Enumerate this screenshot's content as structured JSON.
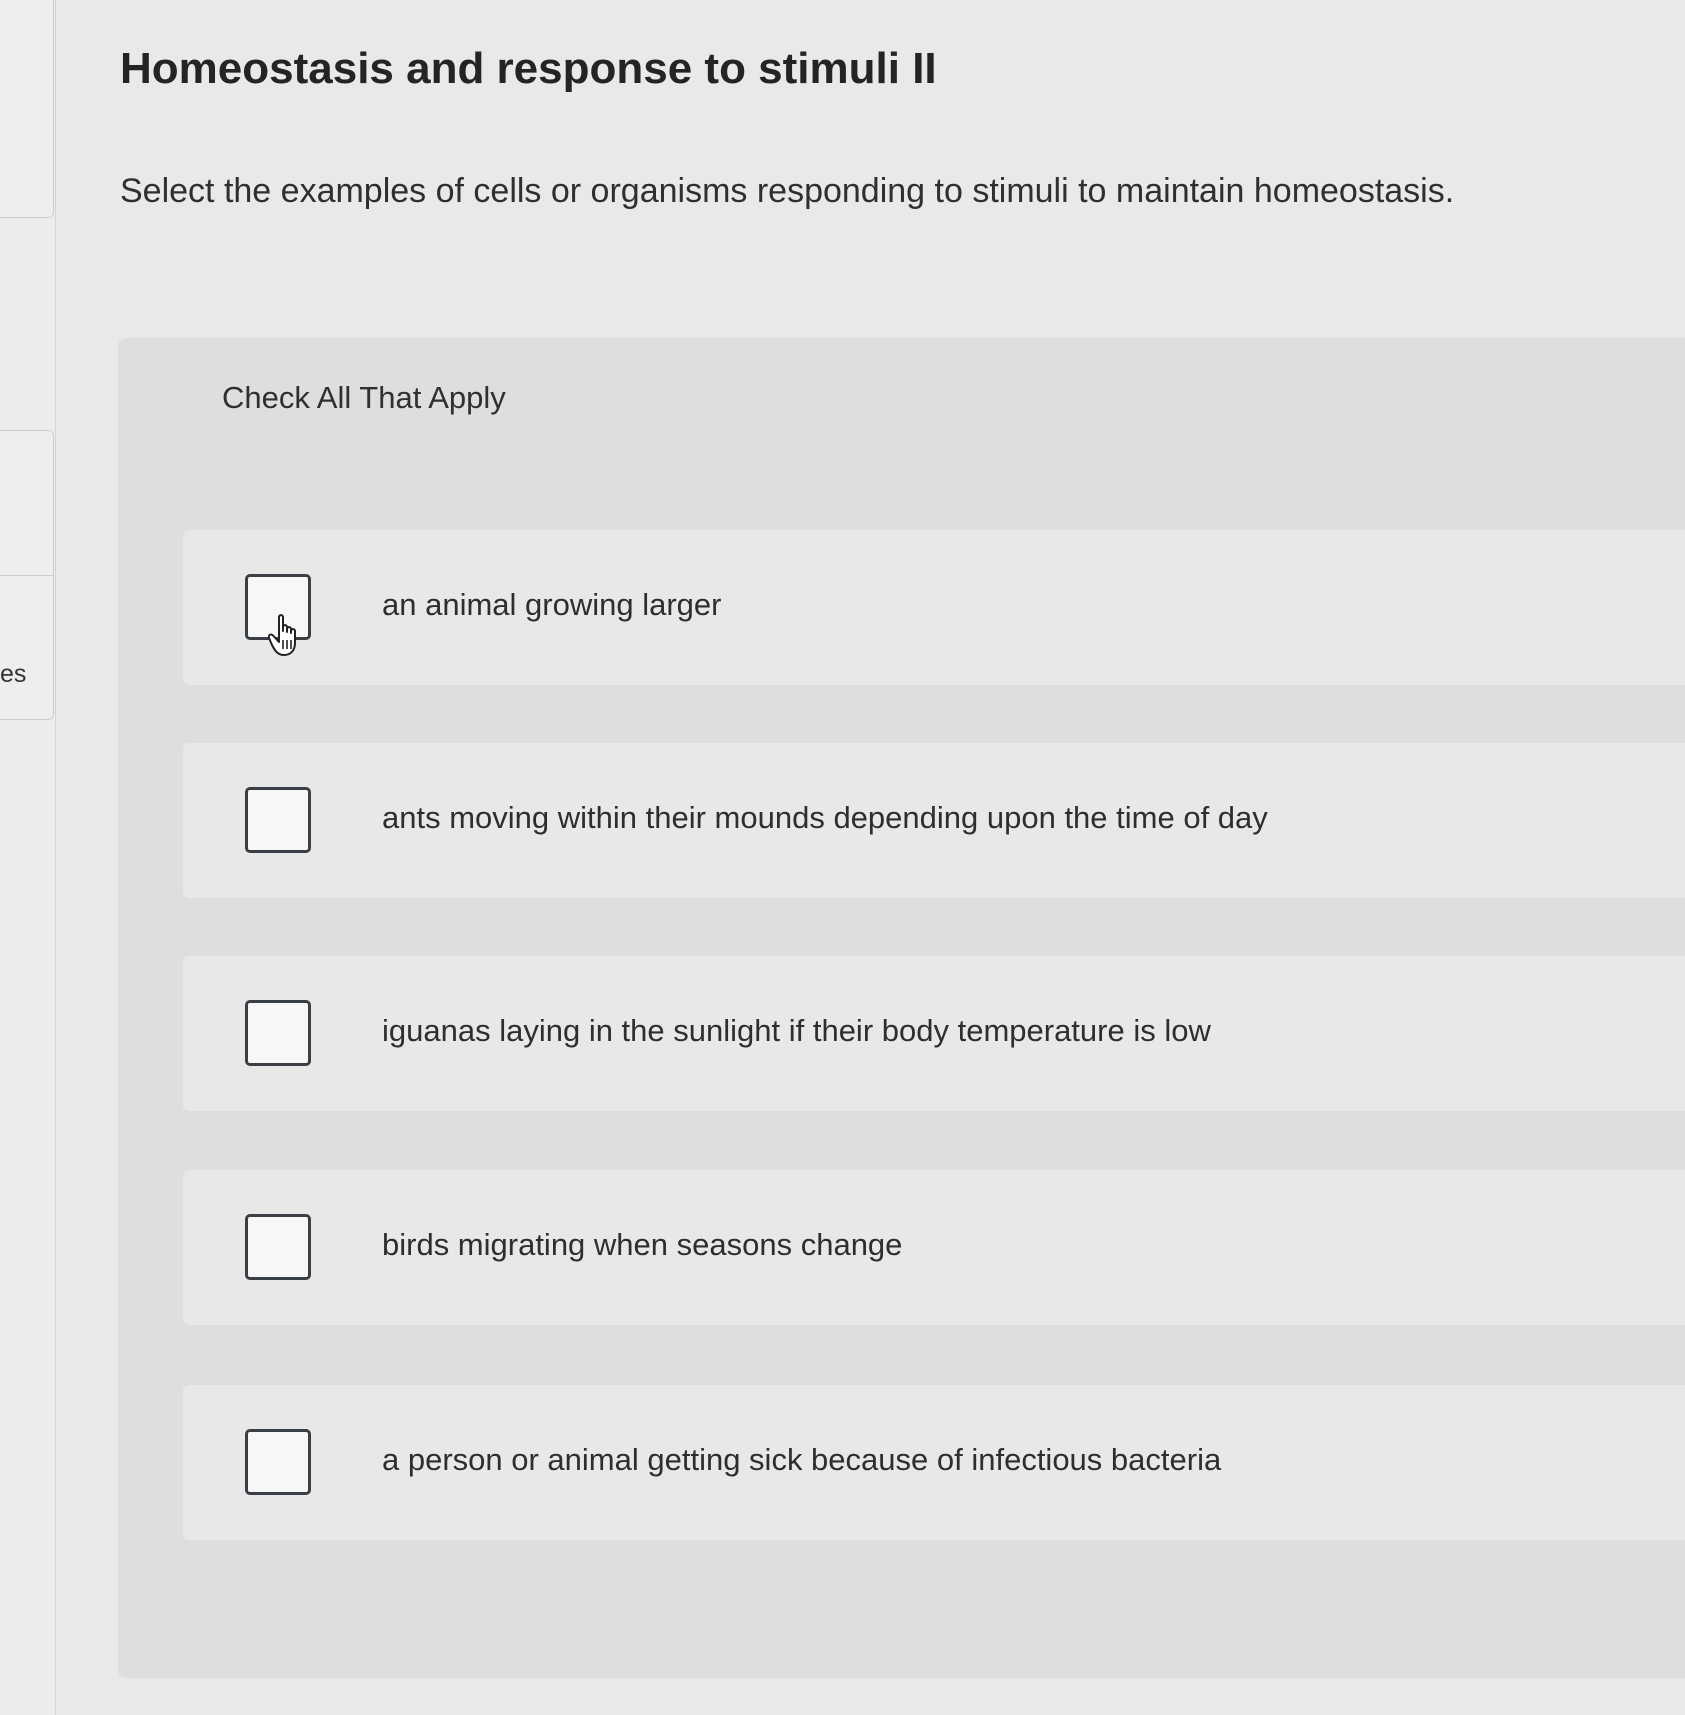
{
  "sidebar": {
    "partial_label": "es"
  },
  "question": {
    "title": "Homeostasis and response to stimuli II",
    "prompt": "Select the examples of cells or organisms responding to stimuli to maintain homeostasis.",
    "instructions": "Check All That Apply",
    "options": [
      {
        "label": "an animal growing larger",
        "checked": false
      },
      {
        "label": "ants moving within their mounds depending upon the time of day",
        "checked": false
      },
      {
        "label": "iguanas laying in the sunlight if their body temperature is low",
        "checked": false
      },
      {
        "label": "birds migrating when seasons change",
        "checked": false
      },
      {
        "label": "a person or animal getting sick because of infectious bacteria",
        "checked": false
      }
    ]
  },
  "cursor": {
    "icon": "hand-pointer-icon"
  },
  "colors": {
    "page_background": "#e9e9e9",
    "panel_background": "#dedede",
    "option_background": "#e8e8e8",
    "checkbox_border": "#3a3f46",
    "text": "#2b2b2b"
  }
}
